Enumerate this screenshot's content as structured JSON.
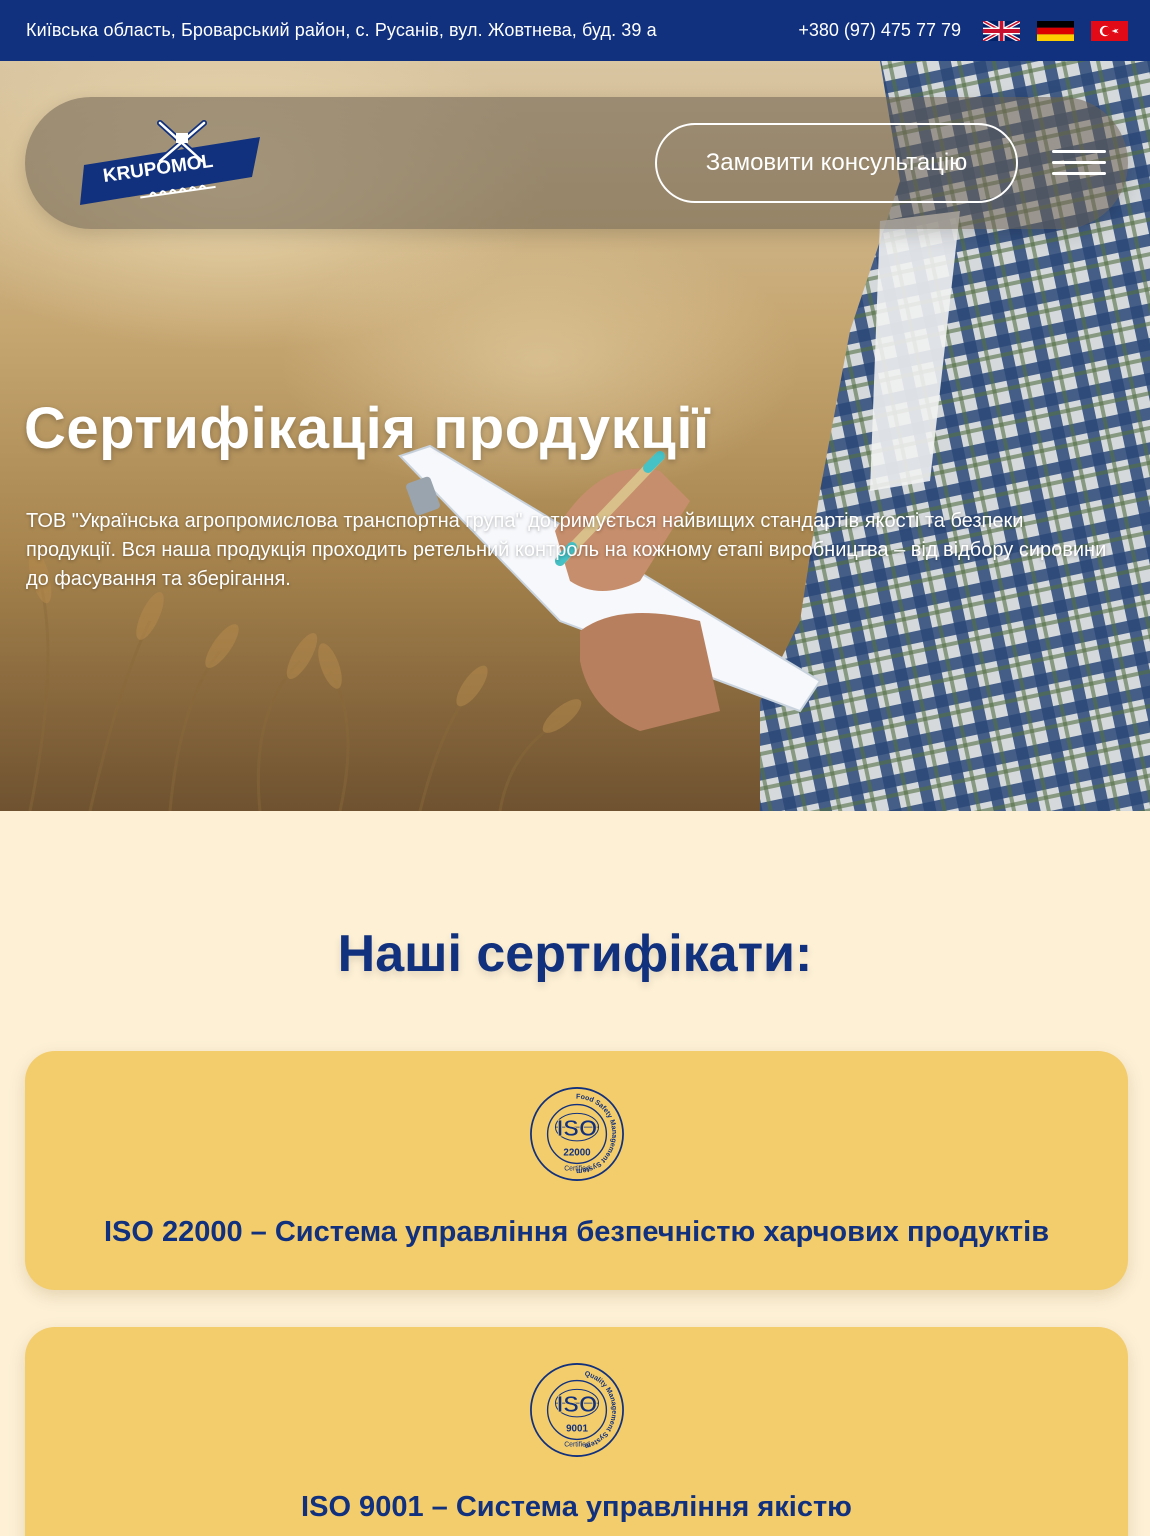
{
  "topbar": {
    "address": "Київська область, Броварський район, с. Русанів, вул. Жовтнева, буд. 39 а",
    "phone": "+380 (97) 475 77 79",
    "languages": [
      "en",
      "de",
      "tr"
    ]
  },
  "header": {
    "logo_text": "KRUPOMOL",
    "consult_button": "Замовити консультацію"
  },
  "hero": {
    "title": "Сертифікація продукції",
    "text": "ТОВ \"Українська агропромислова транспортна група\" дотримується найвищих стандартів якості та безпеки продукції. Вся наша продукція проходить ретельний контроль на кожному етапі виробництва – від відбору сировини до фасування та зберігання."
  },
  "certificates": {
    "title": "Наші сертифікати:",
    "items": [
      {
        "badge_ring": "Food Safety Management System",
        "badge_code": "ISO",
        "badge_number": "22000",
        "badge_sub": "Certified",
        "title": "ISO 22000 – Система управління безпечністю харчових продуктів"
      },
      {
        "badge_ring": "Quality Management System",
        "badge_code": "ISO",
        "badge_number": "9001",
        "badge_sub": "Certified",
        "title": "ISO 9001 – Система управління якістю"
      }
    ]
  },
  "colors": {
    "primary": "#11317e",
    "background": "#fdf0d5",
    "card": "#f3cc6c"
  }
}
